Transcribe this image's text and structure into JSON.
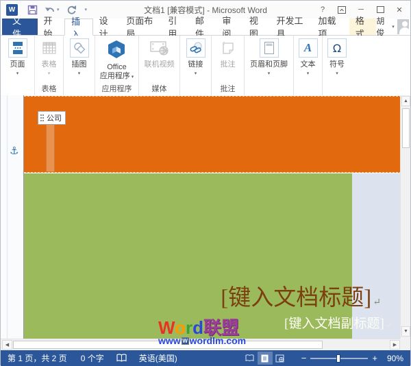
{
  "window": {
    "title": "文档1 [兼容模式] - Microsoft Word",
    "help_label": "?",
    "user_name": "胡俊"
  },
  "tabs": {
    "file": "文件",
    "items": [
      "开始",
      "插入",
      "设计",
      "页面布局",
      "引用",
      "邮件",
      "审阅",
      "视图",
      "开发工具",
      "加载项"
    ],
    "active": "插入",
    "contextual": "格式"
  },
  "ribbon": {
    "buttons": [
      {
        "label": "页面",
        "caption": "",
        "disabled": false
      },
      {
        "label": "表格",
        "caption": "表格",
        "disabled": true
      },
      {
        "label": "插图",
        "caption": "",
        "disabled": false
      },
      {
        "label1": "Office",
        "label2": "应用程序",
        "caption": "应用程序",
        "disabled": false
      },
      {
        "label": "联机视频",
        "caption": "媒体",
        "disabled": true
      },
      {
        "label": "链接",
        "caption": "",
        "disabled": false
      },
      {
        "label": "批注",
        "caption": "批注",
        "disabled": true
      },
      {
        "label": "页眉和页脚",
        "caption": "",
        "disabled": false
      },
      {
        "label": "文本",
        "caption": "",
        "disabled": false
      },
      {
        "label": "符号",
        "caption": "",
        "disabled": false
      }
    ],
    "dropdown_glyph": "▾",
    "omega_glyph": "Ω",
    "text_glyph": "A"
  },
  "document": {
    "company_tag": "公司",
    "title_placeholder": "[键入文档标题]",
    "subtitle_placeholder": "[键入文档副标题]",
    "paragraph_mark": "↵"
  },
  "status_bar": {
    "page_info": "第 1 页，共 2 页",
    "word_count": "0 个字",
    "language": "英语(美国)",
    "zoom_out": "−",
    "zoom_in": "+",
    "zoom_level": "90%"
  },
  "watermark": {
    "brand": [
      {
        "ch": "W",
        "color": "#e93223"
      },
      {
        "ch": "o",
        "color": "#ff9a00"
      },
      {
        "ch": "r",
        "color": "#39a135"
      },
      {
        "ch": "d",
        "color": "#2a48dc"
      },
      {
        "ch": "联盟",
        "color": "#9c3d9c"
      }
    ],
    "url_prefix": "www",
    "url_mini_logo": "W",
    "url_suffix": "wordlm.com"
  },
  "colors": {
    "accent_blue": "#2b579a",
    "icon_blue": "#2e74b5",
    "band_orange": "#e2690d",
    "page_green": "#9bba5c",
    "beyond_page": "#dce3ef",
    "title_brown": "#7b3f10",
    "contextual_tab_bg": "#fdf4dc"
  }
}
